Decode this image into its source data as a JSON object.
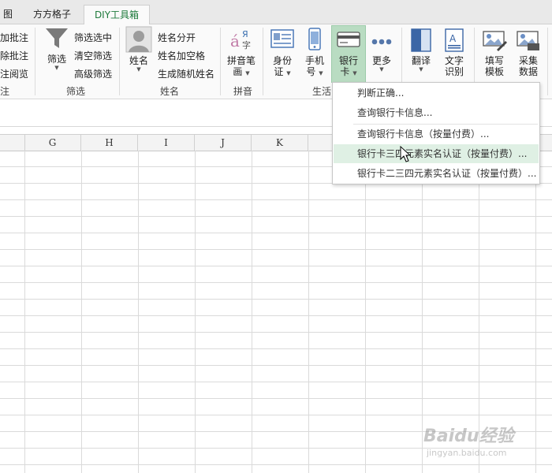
{
  "tabs": [
    {
      "label": "图"
    },
    {
      "label": "方方格子"
    },
    {
      "label": "DIY工具箱"
    }
  ],
  "ribbon": {
    "comment_group": {
      "items": [
        "加批注",
        "除批注",
        "注阅览"
      ],
      "label": "注"
    },
    "filter_group": {
      "big_label": "筛选",
      "items": [
        "筛选选中",
        "清空筛选",
        "高级筛选"
      ],
      "label": "筛选"
    },
    "name_group": {
      "big_label": "姓名",
      "items": [
        "姓名分开",
        "姓名加空格",
        "生成随机姓名"
      ],
      "label": "姓名"
    },
    "pinyin_group": {
      "big_label_1": "拼音笔",
      "big_label_2": "画",
      "label": "拼音"
    },
    "life_group": {
      "id_label_1": "身份",
      "id_label_2": "证",
      "phone_label_1": "手机",
      "phone_label_2": "号",
      "bank_label_1": "银行",
      "bank_label_2": "卡",
      "more_label": "更多",
      "label": "生活"
    },
    "translate": {
      "label": "翻译"
    },
    "ocr": {
      "label_1": "文字",
      "label_2": "识别"
    },
    "fill_template": {
      "label_1": "填写",
      "label_2": "模板"
    },
    "collect_data": {
      "label_1": "采集",
      "label_2": "数据"
    }
  },
  "columns": [
    "G",
    "H",
    "I",
    "J",
    "K"
  ],
  "bank_menu": {
    "items": [
      {
        "label": "判断正确..."
      },
      {
        "label": "查询银行卡信息..."
      },
      {
        "label": "查询银行卡信息（按量付费）..."
      },
      {
        "label": "银行卡三四元素实名认证（按量付费）..."
      },
      {
        "label": "银行卡二三四元素实名认证（按量付费）..."
      }
    ],
    "highlight_index": 3
  },
  "watermark": {
    "brand": "Baidu经验",
    "url": "jingyan.baidu.com"
  },
  "colors": {
    "accent": "#1e7a3c",
    "active_btn": "#b9dcc2",
    "highlight": "#dff0e4"
  }
}
